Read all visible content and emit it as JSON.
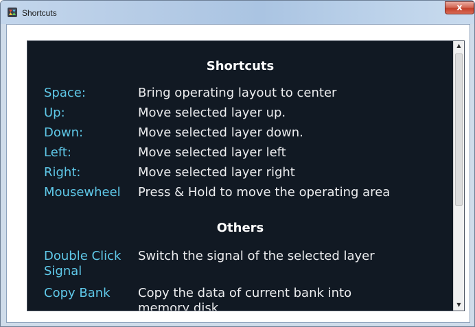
{
  "window": {
    "title": "Shortcuts",
    "close_glyph": "x"
  },
  "panel": {
    "heading": "Shortcuts",
    "shortcuts": [
      {
        "key": "Space:",
        "desc": "Bring operating layout to center"
      },
      {
        "key": "Up:",
        "desc": "Move selected layer up."
      },
      {
        "key": "Down:",
        "desc": "Move selected layer down."
      },
      {
        "key": "Left:",
        "desc": "Move selected layer left"
      },
      {
        "key": "Right:",
        "desc": "Move selected layer right"
      },
      {
        "key": "Mousewheel",
        "desc": "Press & Hold to move the operating area"
      }
    ],
    "others_heading": "Others",
    "others": [
      {
        "key": "Double Click Signal",
        "desc": "Switch the signal of the selected layer"
      },
      {
        "key": "Copy Bank",
        "desc": "Copy the data of current bank into memory disk"
      }
    ]
  },
  "colors": {
    "panel_bg": "#111923",
    "key_text": "#5fc8e8",
    "desc_text": "#ecedef",
    "heading_text": "#ffffff"
  },
  "icons": {
    "app": "app-logo-icon",
    "scroll_up": "scroll-up-arrow-icon",
    "scroll_down": "scroll-down-arrow-icon"
  }
}
